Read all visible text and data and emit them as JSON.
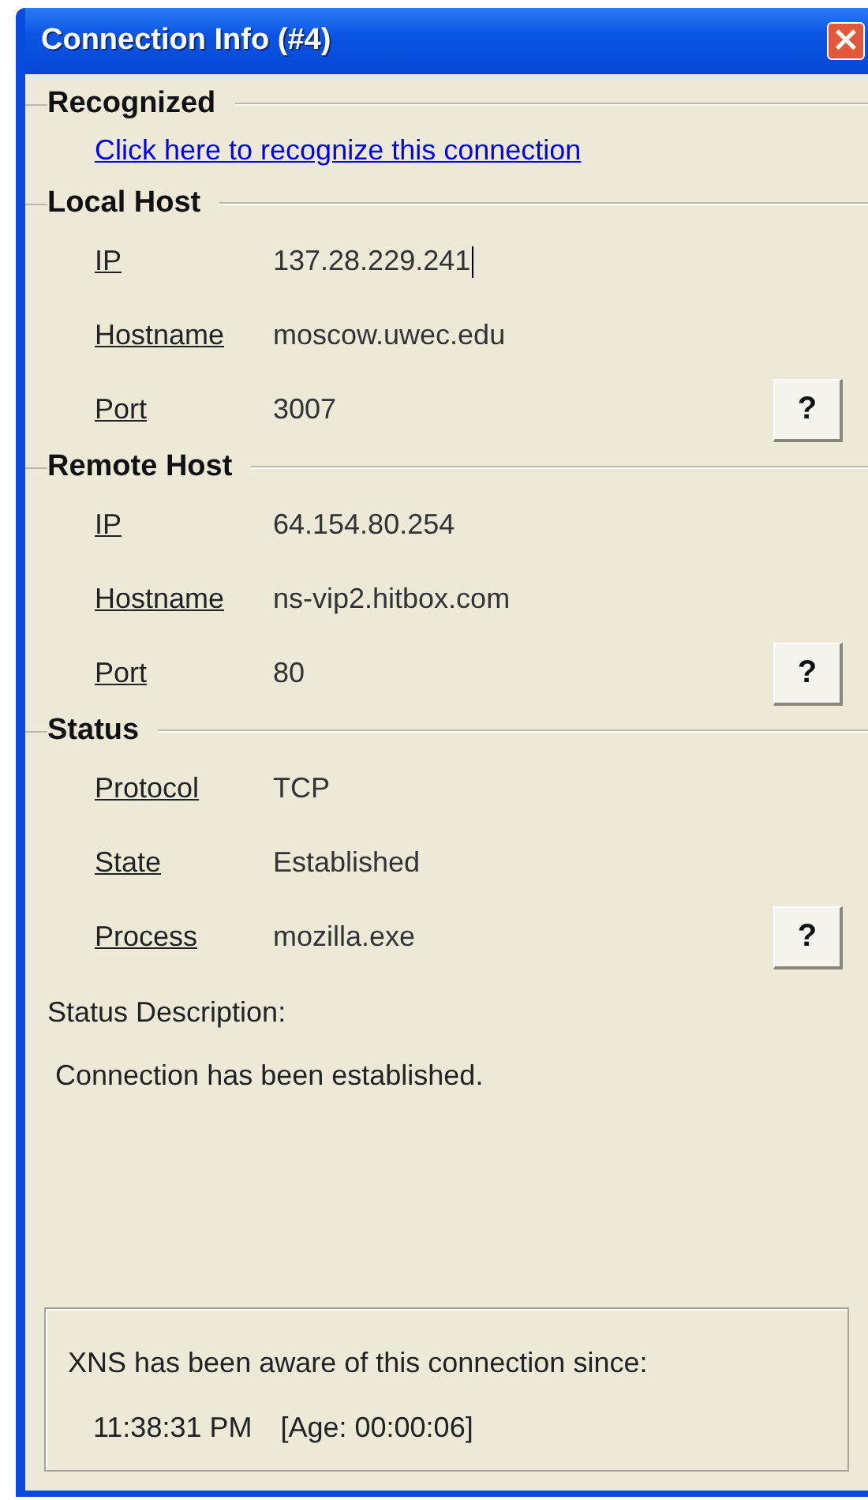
{
  "window": {
    "title": "Connection Info (#4)",
    "close_button": "×"
  },
  "sections": [
    {
      "heading": "Recognized",
      "kind": "link",
      "link": "Click here to recognize this connection"
    },
    {
      "heading": "Local Host",
      "kind": "fields",
      "fields": [
        {
          "label": "IP",
          "value": "137.28.229.241",
          "focused": true
        },
        {
          "label": "Hostname",
          "value": "moscow.uwec.edu",
          "focused": false
        },
        {
          "label": "Port",
          "value": "3007",
          "focused": false,
          "help": "?"
        }
      ]
    },
    {
      "heading": "Remote Host",
      "kind": "fields",
      "fields": [
        {
          "label": "IP",
          "value": "64.154.80.254",
          "focused": false
        },
        {
          "label": "Hostname",
          "value": "ns-vip2.hitbox.com",
          "focused": false
        },
        {
          "label": "Port",
          "value": "80",
          "focused": false,
          "help": "?"
        }
      ]
    },
    {
      "heading": "Status",
      "kind": "fields",
      "fields": [
        {
          "label": "Protocol",
          "value": "TCP",
          "focused": false
        },
        {
          "label": "State",
          "value": "Established",
          "focused": false
        },
        {
          "label": "Process",
          "value": "mozilla.exe",
          "focused": false,
          "help": "?"
        }
      ]
    }
  ],
  "status_description": {
    "label": "Status Description:",
    "text": "Connection has been established."
  },
  "awareness": {
    "text": "XNS has been aware of this connection since:",
    "time": "11:38:31 PM",
    "age": "[Age: 00:00:06]"
  }
}
